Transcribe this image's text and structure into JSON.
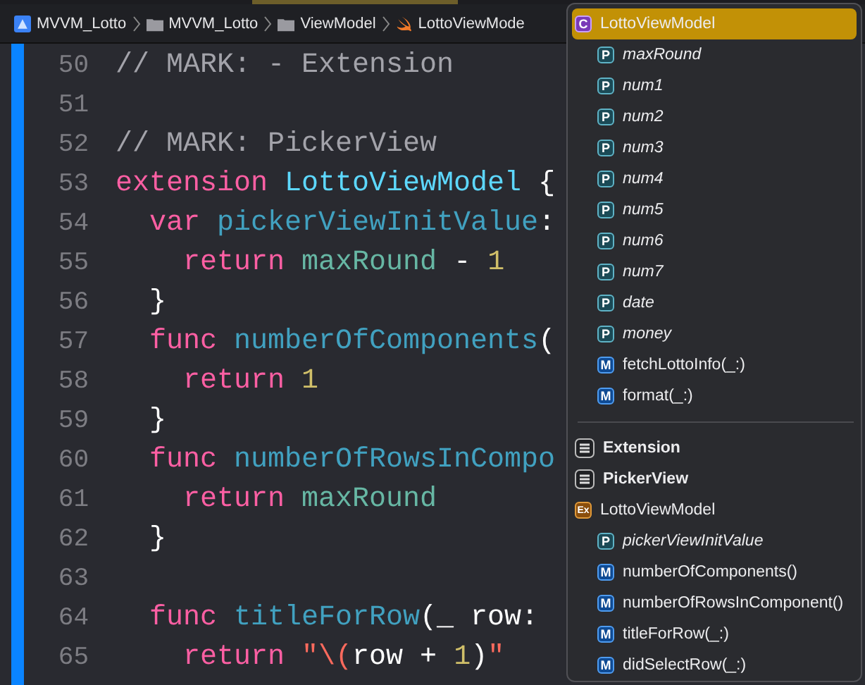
{
  "breadcrumbs": [
    {
      "kind": "project",
      "label": "MVVM_Lotto"
    },
    {
      "kind": "folder",
      "label": "MVVM_Lotto"
    },
    {
      "kind": "folder",
      "label": "ViewModel"
    },
    {
      "kind": "swift",
      "label": "LottoViewMode"
    }
  ],
  "code": [
    {
      "number": "50",
      "tokens": [
        {
          "kind": "comment",
          "text": "// MARK: - Extension"
        }
      ]
    },
    {
      "number": "51"
    },
    {
      "number": "52",
      "tokens": [
        {
          "kind": "comment",
          "text": "// MARK: PickerView"
        }
      ]
    },
    {
      "number": "53",
      "tokens": [
        {
          "kind": "keyword",
          "text": "extension"
        },
        {
          "kind": "type",
          "text": " LottoViewModel"
        },
        {
          "kind": "plain",
          "text": " {"
        }
      ]
    },
    {
      "number": "54",
      "tokens": [
        {
          "kind": "keyword",
          "text": "  var"
        },
        {
          "kind": "decl",
          "text": " pickerViewInitValue"
        },
        {
          "kind": "plain",
          "text": ":"
        }
      ]
    },
    {
      "number": "55",
      "tokens": [
        {
          "kind": "keyword",
          "text": "    return"
        },
        {
          "kind": "ident",
          "text": " maxRound"
        },
        {
          "kind": "plain",
          "text": " - "
        },
        {
          "kind": "number",
          "text": "1"
        }
      ]
    },
    {
      "number": "56",
      "tokens": [
        {
          "kind": "plain",
          "text": "  }"
        }
      ]
    },
    {
      "number": "57",
      "tokens": [
        {
          "kind": "keyword",
          "text": "  func"
        },
        {
          "kind": "decl",
          "text": " numberOfComponents"
        },
        {
          "kind": "plain",
          "text": "("
        }
      ]
    },
    {
      "number": "58",
      "tokens": [
        {
          "kind": "keyword",
          "text": "    return"
        },
        {
          "kind": "number",
          "text": " 1"
        }
      ]
    },
    {
      "number": "59",
      "tokens": [
        {
          "kind": "plain",
          "text": "  }"
        }
      ]
    },
    {
      "number": "60",
      "tokens": [
        {
          "kind": "keyword",
          "text": "  func"
        },
        {
          "kind": "decl",
          "text": " numberOfRowsInCompo"
        }
      ]
    },
    {
      "number": "61",
      "tokens": [
        {
          "kind": "keyword",
          "text": "    return"
        },
        {
          "kind": "ident",
          "text": " maxRound"
        }
      ]
    },
    {
      "number": "62",
      "tokens": [
        {
          "kind": "plain",
          "text": "  }"
        }
      ]
    },
    {
      "number": "63"
    },
    {
      "number": "64",
      "tokens": [
        {
          "kind": "keyword",
          "text": "  func"
        },
        {
          "kind": "decl",
          "text": " titleForRow"
        },
        {
          "kind": "plain",
          "text": "(_ row: "
        }
      ]
    },
    {
      "number": "65",
      "tokens": [
        {
          "kind": "keyword",
          "text": "    return"
        },
        {
          "kind": "string",
          "text": " \"\\("
        },
        {
          "kind": "plain",
          "text": "row + "
        },
        {
          "kind": "number",
          "text": "1"
        },
        {
          "kind": "plain",
          "text": ")"
        },
        {
          "kind": "string",
          "text": "\""
        }
      ]
    }
  ],
  "symbols": {
    "sections": [
      {
        "items": [
          {
            "kind": "class",
            "badge": "C",
            "label": "LottoViewModel",
            "selected": true,
            "children": [
              {
                "kind": "property",
                "badge": "P",
                "label": "maxRound",
                "selected": false
              },
              {
                "kind": "property",
                "badge": "P",
                "label": "num1",
                "selected": false
              },
              {
                "kind": "property",
                "badge": "P",
                "label": "num2",
                "selected": false
              },
              {
                "kind": "property",
                "badge": "P",
                "label": "num3",
                "selected": false
              },
              {
                "kind": "property",
                "badge": "P",
                "label": "num4",
                "selected": false
              },
              {
                "kind": "property",
                "badge": "P",
                "label": "num5",
                "selected": false
              },
              {
                "kind": "property",
                "badge": "P",
                "label": "num6",
                "selected": false
              },
              {
                "kind": "property",
                "badge": "P",
                "label": "num7",
                "selected": false
              },
              {
                "kind": "property",
                "badge": "P",
                "label": "date",
                "selected": false
              },
              {
                "kind": "property",
                "badge": "P",
                "label": "money",
                "selected": false
              },
              {
                "kind": "method",
                "badge": "M",
                "label": "fetchLottoInfo(_:)",
                "selected": false
              },
              {
                "kind": "method",
                "badge": "M",
                "label": "format(_:)",
                "selected": false
              }
            ]
          }
        ]
      },
      {
        "items": [
          {
            "kind": "mark",
            "label": "Extension",
            "selected": false
          },
          {
            "kind": "mark",
            "label": "PickerView",
            "selected": false
          },
          {
            "kind": "extension",
            "badge": "Ex",
            "label": "LottoViewModel",
            "selected": false,
            "children": [
              {
                "kind": "property",
                "badge": "P",
                "label": "pickerViewInitValue",
                "selected": false
              },
              {
                "kind": "method",
                "badge": "M",
                "label": "numberOfComponents()",
                "selected": false
              },
              {
                "kind": "method",
                "badge": "M",
                "label": "numberOfRowsInComponent()",
                "selected": false
              },
              {
                "kind": "method",
                "badge": "M",
                "label": "titleForRow(_:)",
                "selected": false
              },
              {
                "kind": "method",
                "badge": "M",
                "label": "didSelectRow(_:)",
                "selected": false
              }
            ]
          }
        ]
      }
    ]
  }
}
